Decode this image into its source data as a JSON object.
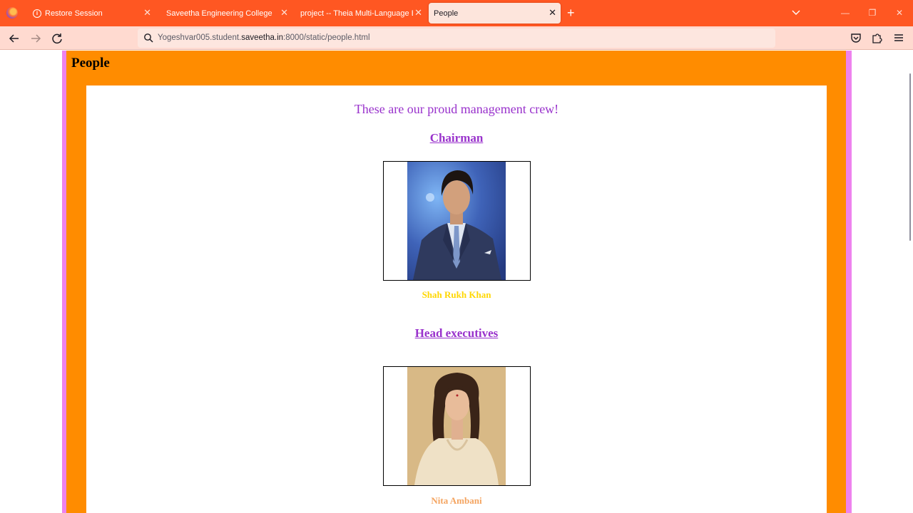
{
  "browser": {
    "tabs": [
      {
        "label": "Restore Session",
        "icon": "info-icon"
      },
      {
        "label": "Saveetha Engineering College"
      },
      {
        "label": "project -- Theia Multi-Language Ex"
      },
      {
        "label": "People",
        "active": true
      }
    ],
    "url": {
      "prefix": "Yogeshvar005.student.",
      "host": "saveetha.in",
      "suffix": ":8000/static/people.html"
    },
    "colors": {
      "tabbar": "#ff5722",
      "navbar": "#ffdad0"
    }
  },
  "page": {
    "heading": "People",
    "tagline": "These are our proud management crew!",
    "sections": [
      {
        "title": "Chairman",
        "person": {
          "name": "Shah Rukh Khan",
          "name_color": "#ffd700",
          "photo": "chairman-photo"
        }
      },
      {
        "title": "Head executives",
        "person": {
          "name": "Nita Ambani",
          "name_color": "#f4a460",
          "photo": "executive-photo"
        }
      }
    ],
    "colors": {
      "outer_border": "#ee82ee",
      "frame": "#ff8c00",
      "text": "#9932cc"
    }
  }
}
